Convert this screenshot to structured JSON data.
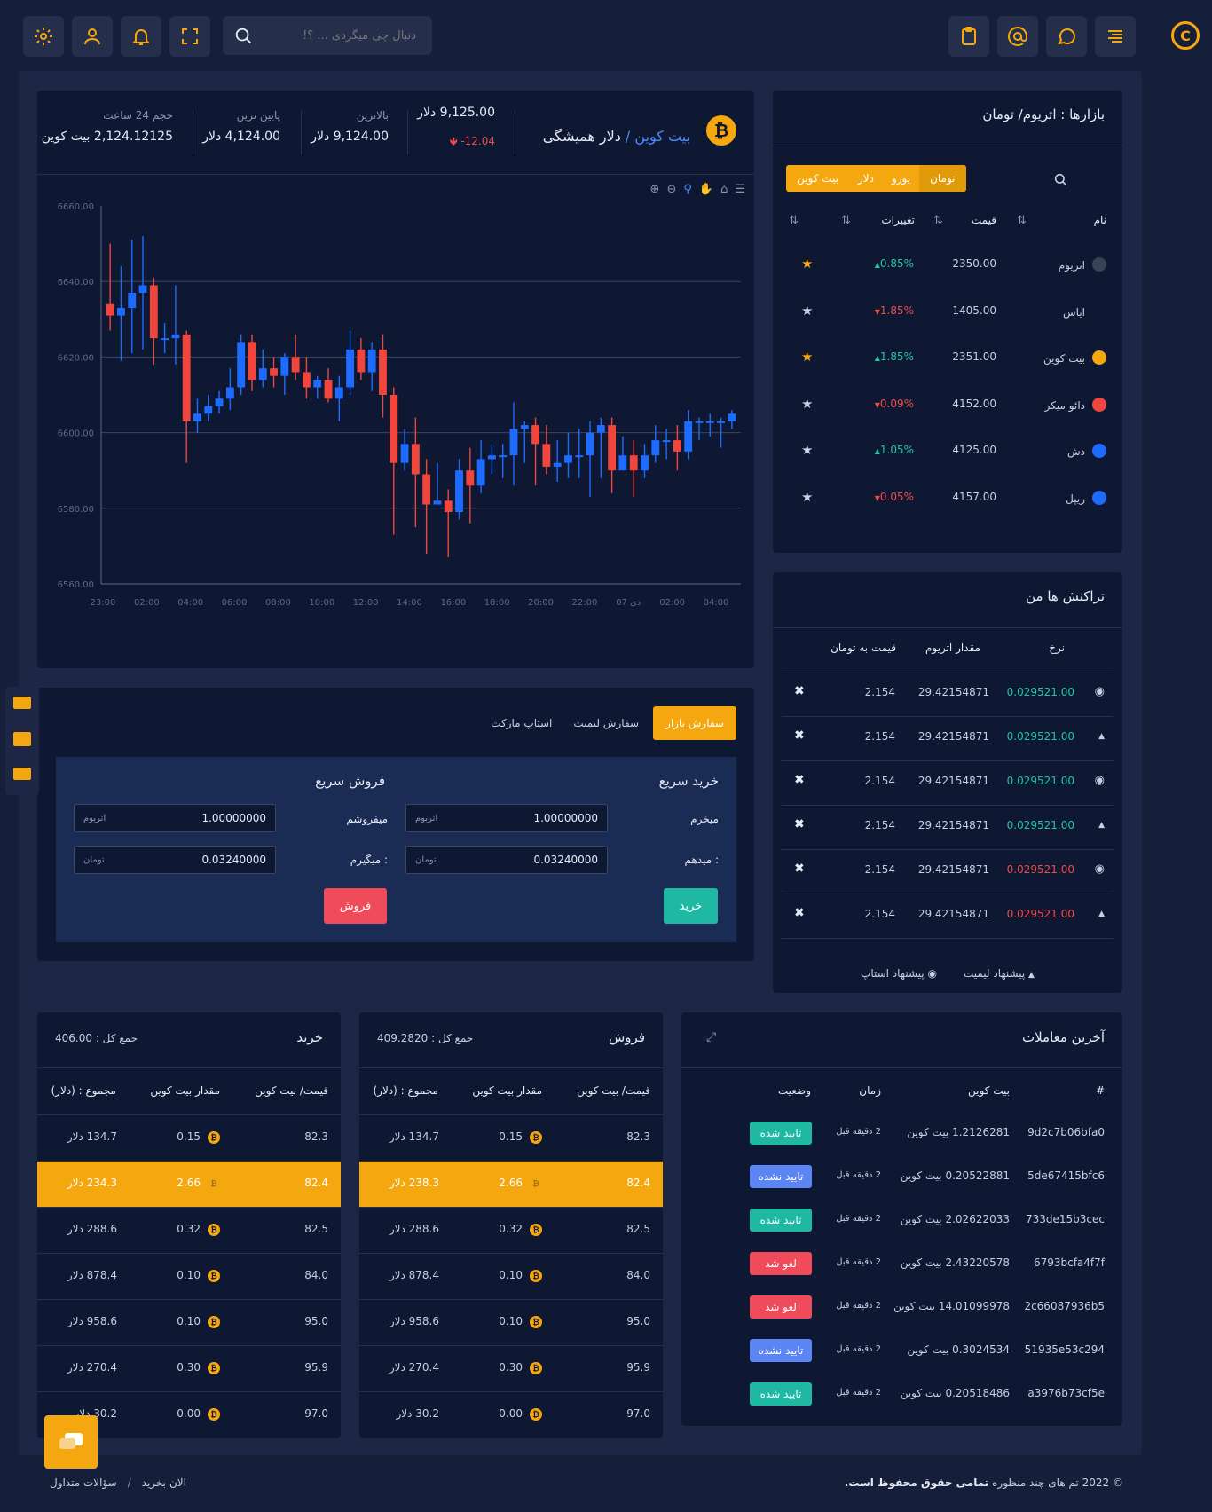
{
  "header": {
    "search_placeholder": "دنبال چی میگردی ... ؟!",
    "icons": [
      "gear-icon",
      "user-icon",
      "bell-icon",
      "fullscreen-icon",
      "search-icon",
      "clipboard-icon",
      "at-icon",
      "chat-icon",
      "menu-icon",
      "logo-icon"
    ]
  },
  "ticker": {
    "pair_base": "بیت کوین",
    "pair_sep": "/",
    "pair_quote": "دلار همیشگی",
    "price": "9,125.00 دلار",
    "change": "-12.04",
    "high_label": "بالاترین",
    "high_value": "9,124.00 دلار",
    "low_label": "پایین ترین",
    "low_value": "4,124.00 دلار",
    "vol_label": "حجم 24 ساعت",
    "vol_value": "2,124.12125 بیت کوین"
  },
  "chart_data": {
    "type": "candlestick",
    "y_ticks": [
      "6660.00",
      "6640.00",
      "6620.00",
      "6600.00",
      "6580.00",
      "6560.00"
    ],
    "ylim": [
      6560,
      6660
    ],
    "x_ticks": [
      "23:00",
      "02:00",
      "04:00",
      "06:00",
      "08:00",
      "10:00",
      "12:00",
      "14:00",
      "16:00",
      "18:00",
      "20:00",
      "22:00",
      "07 دی",
      "02:00",
      "04:00"
    ],
    "up_color": "#1e6bff",
    "down_color": "#f0463e",
    "candles": [
      [
        6634,
        6631,
        6650,
        6627
      ],
      [
        6631,
        6633,
        6644,
        6619
      ],
      [
        6633,
        6637,
        6651,
        6621
      ],
      [
        6637,
        6639,
        6652,
        6622
      ],
      [
        6639,
        6625,
        6641,
        6618
      ],
      [
        6625,
        6625,
        6629,
        6621
      ],
      [
        6625,
        6626,
        6639,
        6618
      ],
      [
        6626,
        6603,
        6627,
        6592
      ],
      [
        6603,
        6605,
        6609,
        6600
      ],
      [
        6605,
        6607,
        6610,
        6603
      ],
      [
        6607,
        6609,
        6611,
        6605
      ],
      [
        6609,
        6612,
        6617,
        6606
      ],
      [
        6612,
        6624,
        6626,
        6610
      ],
      [
        6624,
        6614,
        6626,
        6611
      ],
      [
        6614,
        6617,
        6622,
        6612
      ],
      [
        6617,
        6615,
        6620,
        6612
      ],
      [
        6615,
        6620,
        6621,
        6610
      ],
      [
        6620,
        6616,
        6626,
        6614
      ],
      [
        6616,
        6612,
        6620,
        6609
      ],
      [
        6612,
        6614,
        6615,
        6609
      ],
      [
        6614,
        6609,
        6617,
        6608
      ],
      [
        6609,
        6612,
        6615,
        6603
      ],
      [
        6612,
        6622,
        6627,
        6610
      ],
      [
        6622,
        6616,
        6625,
        6614
      ],
      [
        6616,
        6622,
        6624,
        6611
      ],
      [
        6622,
        6610,
        6626,
        6604
      ],
      [
        6610,
        6592,
        6612,
        6573
      ],
      [
        6592,
        6597,
        6601,
        6590
      ],
      [
        6597,
        6589,
        6604,
        6575
      ],
      [
        6589,
        6581,
        6593,
        6568
      ],
      [
        6581,
        6582,
        6592,
        6581
      ],
      [
        6582,
        6579,
        6585,
        6567
      ],
      [
        6579,
        6590,
        6593,
        6577
      ],
      [
        6590,
        6586,
        6596,
        6576
      ],
      [
        6586,
        6593,
        6598,
        6584
      ],
      [
        6593,
        6594,
        6597,
        6589
      ],
      [
        6594,
        6594,
        6597,
        6588
      ],
      [
        6594,
        6601,
        6608,
        6586
      ],
      [
        6601,
        6602,
        6603,
        6592
      ],
      [
        6602,
        6597,
        6604,
        6586
      ],
      [
        6597,
        6591,
        6602,
        6589
      ],
      [
        6591,
        6592,
        6598,
        6587
      ],
      [
        6592,
        6594,
        6600,
        6588
      ],
      [
        6594,
        6594,
        6601,
        6588
      ],
      [
        6594,
        6600,
        6603,
        6583
      ],
      [
        6600,
        6602,
        6604,
        6588
      ],
      [
        6602,
        6590,
        6604,
        6584
      ],
      [
        6590,
        6594,
        6599,
        6590
      ],
      [
        6594,
        6590,
        6598,
        6583
      ],
      [
        6590,
        6594,
        6597,
        6588
      ],
      [
        6594,
        6598,
        6602,
        6592
      ],
      [
        6598,
        6598,
        6601,
        6593
      ],
      [
        6598,
        6595,
        6602,
        6590
      ],
      [
        6595,
        6603,
        6606,
        6593
      ],
      [
        6603,
        6603,
        6604,
        6598
      ],
      [
        6603,
        6603,
        6605,
        6599
      ],
      [
        6603,
        6603,
        6604,
        6596
      ],
      [
        6603,
        6605,
        6606,
        6601
      ]
    ],
    "toolbar_icons": [
      "zoom-in-icon",
      "zoom-out-icon",
      "magnifier-icon",
      "pan-icon",
      "home-icon",
      "menu-icon"
    ]
  },
  "markets": {
    "title": "بازارها : اتریوم/ تومان",
    "tabs": [
      "تومان",
      "یورو",
      "دلار",
      "بیت کوین"
    ],
    "columns": [
      "نام",
      "قیمت",
      "تغییرات"
    ],
    "rows": [
      {
        "name": "اتریوم",
        "price": "2350.00",
        "change": "0.85%",
        "dir": "up",
        "starred": true,
        "icon": "ethereum-icon",
        "icon_color": "#3a4256"
      },
      {
        "name": "ایاس",
        "price": "1405.00",
        "change": "1.85%",
        "dir": "down",
        "starred": false,
        "icon": "eos-icon",
        "icon_color": "#0f1832"
      },
      {
        "name": "بیت کوین",
        "price": "2351.00",
        "change": "1.85%",
        "dir": "up",
        "starred": true,
        "icon": "bitcoin-icon",
        "icon_color": "#f5a70f"
      },
      {
        "name": "دائو میکر",
        "price": "4152.00",
        "change": "0.09%",
        "dir": "down",
        "starred": false,
        "icon": "dao-icon",
        "icon_color": "#f0463e"
      },
      {
        "name": "دش",
        "price": "4125.00",
        "change": "1.05%",
        "dir": "up",
        "starred": false,
        "icon": "dash-icon",
        "icon_color": "#1e6bff"
      },
      {
        "name": "ریپل",
        "price": "4157.00",
        "change": "0.05%",
        "dir": "down",
        "starred": false,
        "icon": "ripple-icon",
        "icon_color": "#1e6bff"
      }
    ]
  },
  "transactions": {
    "title": "تراکنش ها من",
    "columns": [
      "نرخ",
      "مقدار اتریوم",
      "قیمت به تومان"
    ],
    "rows": [
      {
        "rate": "0.029521.00",
        "amount": "29.42154871",
        "price": "2.154",
        "type": "circle",
        "color": "green"
      },
      {
        "rate": "0.029521.00",
        "amount": "29.42154871",
        "price": "2.154",
        "type": "tri",
        "color": "green"
      },
      {
        "rate": "0.029521.00",
        "amount": "29.42154871",
        "price": "2.154",
        "type": "circle",
        "color": "green"
      },
      {
        "rate": "0.029521.00",
        "amount": "29.42154871",
        "price": "2.154",
        "type": "tri",
        "color": "green"
      },
      {
        "rate": "0.029521.00",
        "amount": "29.42154871",
        "price": "2.154",
        "type": "circle",
        "color": "red"
      },
      {
        "rate": "0.029521.00",
        "amount": "29.42154871",
        "price": "2.154",
        "type": "tri",
        "color": "red"
      }
    ],
    "legend_limit": "پیشنهاد لیمیت",
    "legend_stop": "پیشنهاد استاپ"
  },
  "order": {
    "tabs": [
      "سفارش بازار",
      "سفارش لیمیت",
      "استاپ مارکت"
    ],
    "buy_title": "خرید سریع",
    "sell_title": "فروش سریع",
    "buy_get_label": "میخرم",
    "buy_pay_label": "میدهم :",
    "sell_give_label": "میفروشم",
    "sell_get_label": "میگیرم :",
    "amount_value": "1.00000000",
    "amount_unit": "اتریوم",
    "price_value": "0.03240000",
    "price_unit": "تومان",
    "buy_button": "خرید",
    "sell_button": "فروش"
  },
  "trades": {
    "title": "آخرین معاملات",
    "columns": [
      "#",
      "بیت کوین",
      "زمان",
      "وضعیت"
    ],
    "rows": [
      {
        "id": "9d2c7b06bfa0",
        "amount": "1.2126281 بیت کوین",
        "time": "2 دقیقه قبل",
        "status": "تایید شده",
        "color": "#1fb8a2"
      },
      {
        "id": "5de67415bfc6",
        "amount": "0.20522881 بیت کوین",
        "time": "2 دقیقه قبل",
        "status": "تایید نشده",
        "color": "#5b84f5"
      },
      {
        "id": "733de15b3cec",
        "amount": "2.02622033 بیت کوین",
        "time": "2 دقیقه قبل",
        "status": "تایید شده",
        "color": "#1fb8a2"
      },
      {
        "id": "6793bcfa4f7f",
        "amount": "2.43220578 بیت کوین",
        "time": "2 دقیقه قبل",
        "status": "لغو شد",
        "color": "#f04b5a"
      },
      {
        "id": "2c66087936b5",
        "amount": "14.01099978 بیت کوین",
        "time": "2 دقیقه قبل",
        "status": "لغو شد",
        "color": "#f04b5a"
      },
      {
        "id": "51935e53c294",
        "amount": "0.3024534 بیت کوین",
        "time": "2 دقیقه قبل",
        "status": "تایید نشده",
        "color": "#5b84f5"
      },
      {
        "id": "a3976b73cf5e",
        "amount": "0.20518486 بیت کوین",
        "time": "2 دقیقه قبل",
        "status": "تایید شده",
        "color": "#1fb8a2"
      }
    ]
  },
  "sell_book": {
    "title": "فروش",
    "total": "جمع کل : 409.2820",
    "columns": [
      "قیمت/ بیت کوین",
      "مقدار بیت کوین",
      "مجموع : (دلار)"
    ],
    "rows": [
      {
        "price": "82.3",
        "amount": "0.15",
        "total": "134.7 دلار",
        "hl": false
      },
      {
        "price": "82.4",
        "amount": "2.66",
        "total": "238.3 دلار",
        "hl": true
      },
      {
        "price": "82.5",
        "amount": "0.32",
        "total": "288.6 دلار",
        "hl": false
      },
      {
        "price": "84.0",
        "amount": "0.10",
        "total": "878.4 دلار",
        "hl": false
      },
      {
        "price": "95.0",
        "amount": "0.10",
        "total": "958.6 دلار",
        "hl": false
      },
      {
        "price": "95.9",
        "amount": "0.30",
        "total": "270.4 دلار",
        "hl": false
      },
      {
        "price": "97.0",
        "amount": "0.00",
        "total": "30.2 دلار",
        "hl": false
      }
    ]
  },
  "buy_book": {
    "title": "خرید",
    "total": "جمع کل : 406.00",
    "columns": [
      "قیمت/ بیت کوین",
      "مقدار بیت کوین",
      "مجموع : (دلار)"
    ],
    "rows": [
      {
        "price": "82.3",
        "amount": "0.15",
        "total": "134.7 دلار",
        "hl": false
      },
      {
        "price": "82.4",
        "amount": "2.66",
        "total": "234.3 دلار",
        "hl": true
      },
      {
        "price": "82.5",
        "amount": "0.32",
        "total": "288.6 دلار",
        "hl": false
      },
      {
        "price": "84.0",
        "amount": "0.10",
        "total": "878.4 دلار",
        "hl": false
      },
      {
        "price": "95.0",
        "amount": "0.10",
        "total": "958.6 دلار",
        "hl": false
      },
      {
        "price": "95.9",
        "amount": "0.30",
        "total": "270.4 دلار",
        "hl": false
      },
      {
        "price": "97.0",
        "amount": "0.00",
        "total": "30.2 دلار",
        "hl": false
      }
    ]
  },
  "footer": {
    "copyright_prefix": "© 2022 تم های چند منظوره",
    "copyright_bold": "تمامی حقوق محفوظ است.",
    "link1": "سؤالات متداول",
    "link2": "الان بخرید"
  },
  "colors": {
    "accent": "#f5a70f",
    "bg": "#161f39",
    "panel": "#0f1832",
    "green": "#22c5a8",
    "red": "#f04b4b"
  }
}
